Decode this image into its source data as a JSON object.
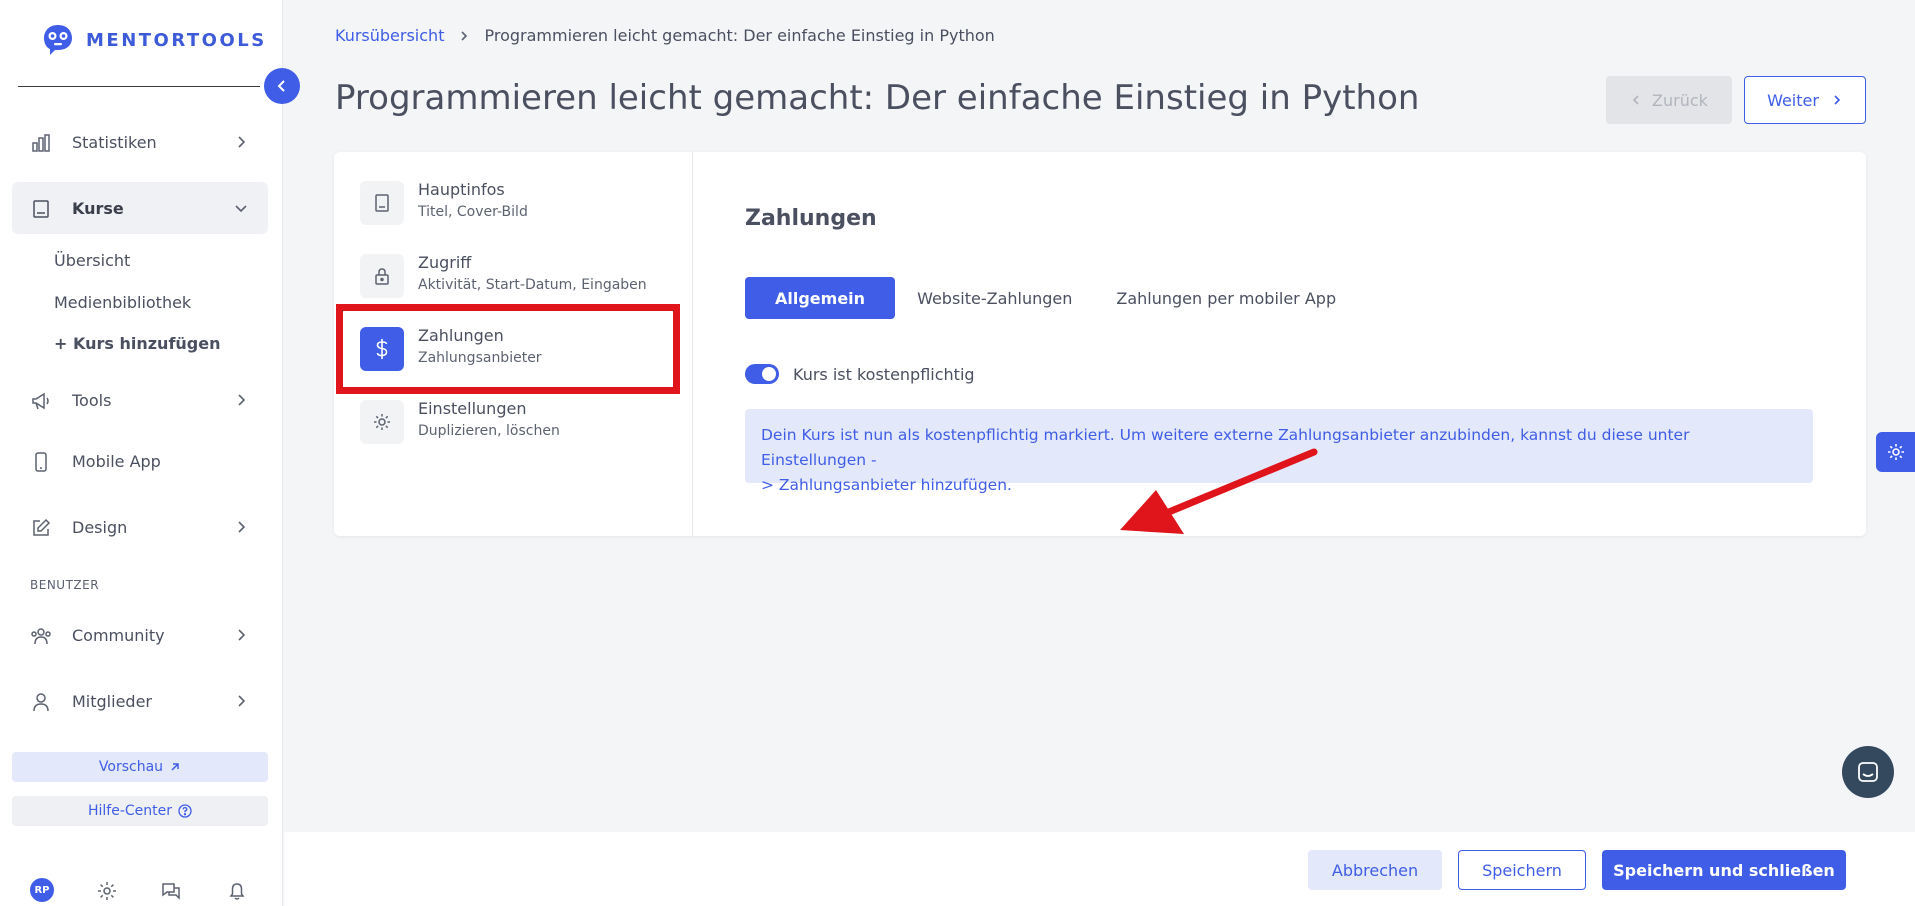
{
  "brand": {
    "name": "MENTORTOOLS",
    "accent": "#3f5de6"
  },
  "sidebar": {
    "items": [
      {
        "label": "Statistiken",
        "icon": "bar-chart-icon"
      },
      {
        "label": "Kurse",
        "icon": "book-icon"
      },
      {
        "label": "Tools",
        "icon": "megaphone-icon"
      },
      {
        "label": "Mobile App",
        "icon": "mobile-icon"
      },
      {
        "label": "Design",
        "icon": "pencil-icon"
      },
      {
        "label": "Community",
        "icon": "users-icon"
      },
      {
        "label": "Mitglieder",
        "icon": "user-icon"
      }
    ],
    "sub_items": [
      "Übersicht",
      "Medienbibliothek",
      "+ Kurs hinzufügen"
    ],
    "section_label": "BENUTZER",
    "preview_label": "Vorschau",
    "help_label": "Hilfe-Center",
    "avatar_initials": "RP"
  },
  "breadcrumb": {
    "link": "Kursübersicht",
    "current": "Programmieren leicht gemacht: Der einfache Einstieg in Python"
  },
  "page_title": "Programmieren leicht gemacht: Der einfache Einstieg in Python",
  "header_buttons": {
    "back": "Zurück",
    "next": "Weiter"
  },
  "steps": [
    {
      "title": "Hauptinfos",
      "subtitle": "Titel, Cover-Bild",
      "icon": "book-icon"
    },
    {
      "title": "Zugriff",
      "subtitle": "Aktivität, Start-Datum, Eingaben",
      "icon": "lock-icon"
    },
    {
      "title": "Zahlungen",
      "subtitle": "Zahlungsanbieter",
      "icon": "dollar-icon",
      "active": true
    },
    {
      "title": "Einstellungen",
      "subtitle": "Duplizieren, löschen",
      "icon": "gear-icon"
    }
  ],
  "payments": {
    "title": "Zahlungen",
    "tabs": [
      "Allgemein",
      "Website-Zahlungen",
      "Zahlungen per mobiler App"
    ],
    "active_tab": "Allgemein",
    "toggle_label": "Kurs ist kostenpflichtig",
    "toggle_on": true,
    "info_line1": "Dein Kurs ist nun als kostenpflichtig markiert. Um weitere externe Zahlungsanbieter anzubinden, kannst du diese unter Einstellungen -",
    "info_line2": "> Zahlungsanbieter hinzufügen."
  },
  "footer": {
    "cancel": "Abbrechen",
    "save": "Speichern",
    "save_close": "Speichern und schließen"
  }
}
